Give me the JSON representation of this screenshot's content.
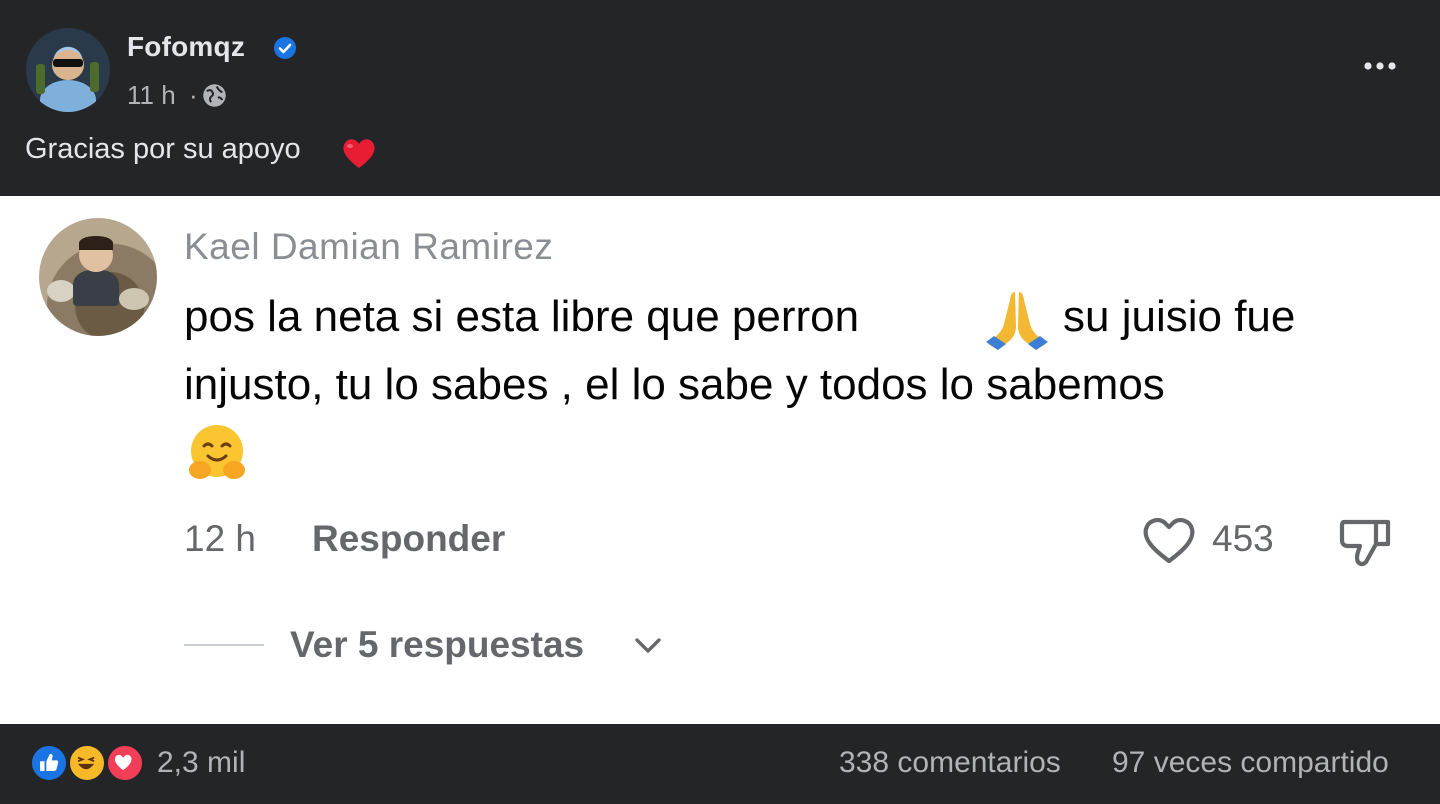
{
  "post": {
    "author": "Fofomqz",
    "time": "11 h",
    "separator": "·",
    "text": "Gracias por su apoyo",
    "icons": [
      "verified-badge-icon",
      "globe-icon",
      "more-options-icon",
      "red-heart-emoji"
    ]
  },
  "comment": {
    "author": "Kael Damian Ramirez",
    "text_line1a": "pos la neta si esta libre que perron",
    "text_line1b": "su juisio fue",
    "text_line2": "injusto, tu lo sabes , el lo sabe y todos lo sabemos",
    "emojis": [
      "folded-hands-emoji",
      "hugging-face-emoji"
    ],
    "time": "12 h",
    "reply_label": "Responder",
    "likes": "453",
    "view_replies_label": "Ver 5 respuestas"
  },
  "reactions": {
    "types": [
      "like",
      "haha",
      "love"
    ],
    "count": "2,3 mil",
    "comments": "338 comentarios",
    "shares": "97 veces compartido"
  },
  "colors": {
    "dark_bg": "#242526",
    "primary_text_dark": "#e4e6eb",
    "secondary_text_dark": "#b0b3b8",
    "card_bg": "#ffffff",
    "verified_blue": "#1b74e4"
  }
}
